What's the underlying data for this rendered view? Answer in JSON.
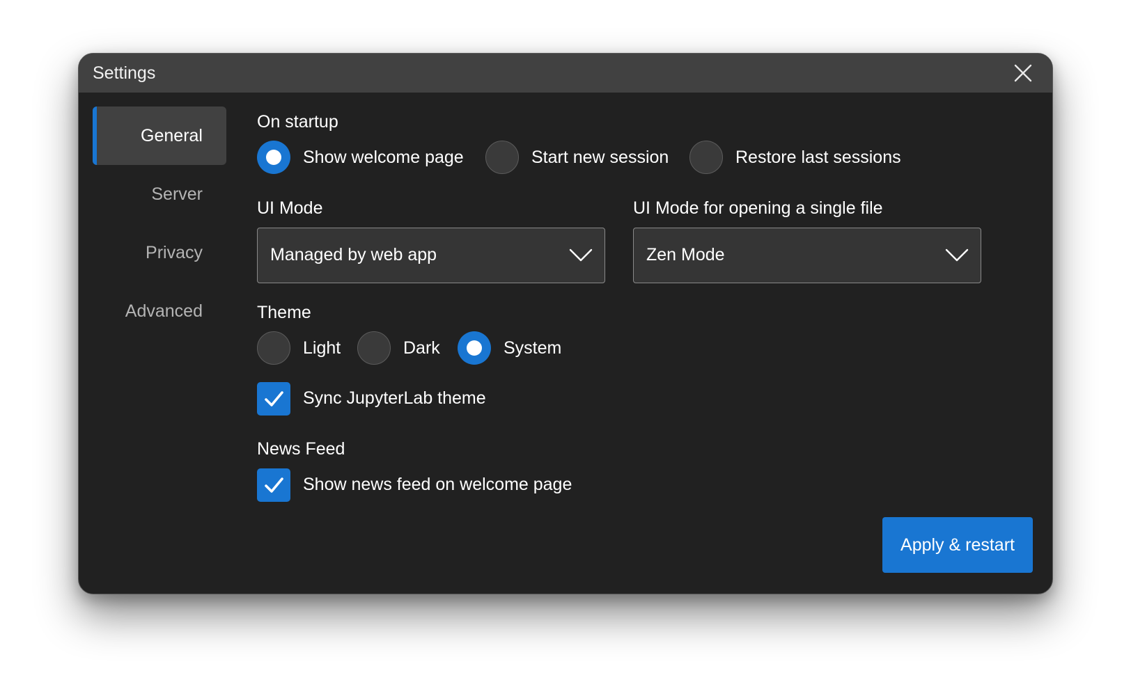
{
  "window": {
    "title": "Settings"
  },
  "icons": {
    "close": "close-icon",
    "chevron": "chevron-down-icon",
    "check": "checkmark-icon"
  },
  "colors": {
    "accent": "#1976d2",
    "background": "#212121",
    "titlebar": "#414141"
  },
  "sidebar": {
    "items": [
      {
        "label": "General",
        "active": true
      },
      {
        "label": "Server",
        "active": false
      },
      {
        "label": "Privacy",
        "active": false
      },
      {
        "label": "Advanced",
        "active": false
      }
    ]
  },
  "startup": {
    "label": "On startup",
    "options": [
      {
        "label": "Show welcome page",
        "checked": true
      },
      {
        "label": "Start new session",
        "checked": false
      },
      {
        "label": "Restore last sessions",
        "checked": false
      }
    ]
  },
  "ui_mode": {
    "label": "UI Mode",
    "value": "Managed by web app"
  },
  "ui_mode_single": {
    "label": "UI Mode for opening a single file",
    "value": "Zen Mode"
  },
  "theme": {
    "label": "Theme",
    "options": [
      {
        "label": "Light",
        "checked": false
      },
      {
        "label": "Dark",
        "checked": false
      },
      {
        "label": "System",
        "checked": true
      }
    ],
    "sync_label": "Sync JupyterLab theme",
    "sync_checked": true
  },
  "news": {
    "label": "News Feed",
    "show_label": "Show news feed on welcome page",
    "show_checked": true
  },
  "actions": {
    "apply_label": "Apply & restart"
  }
}
